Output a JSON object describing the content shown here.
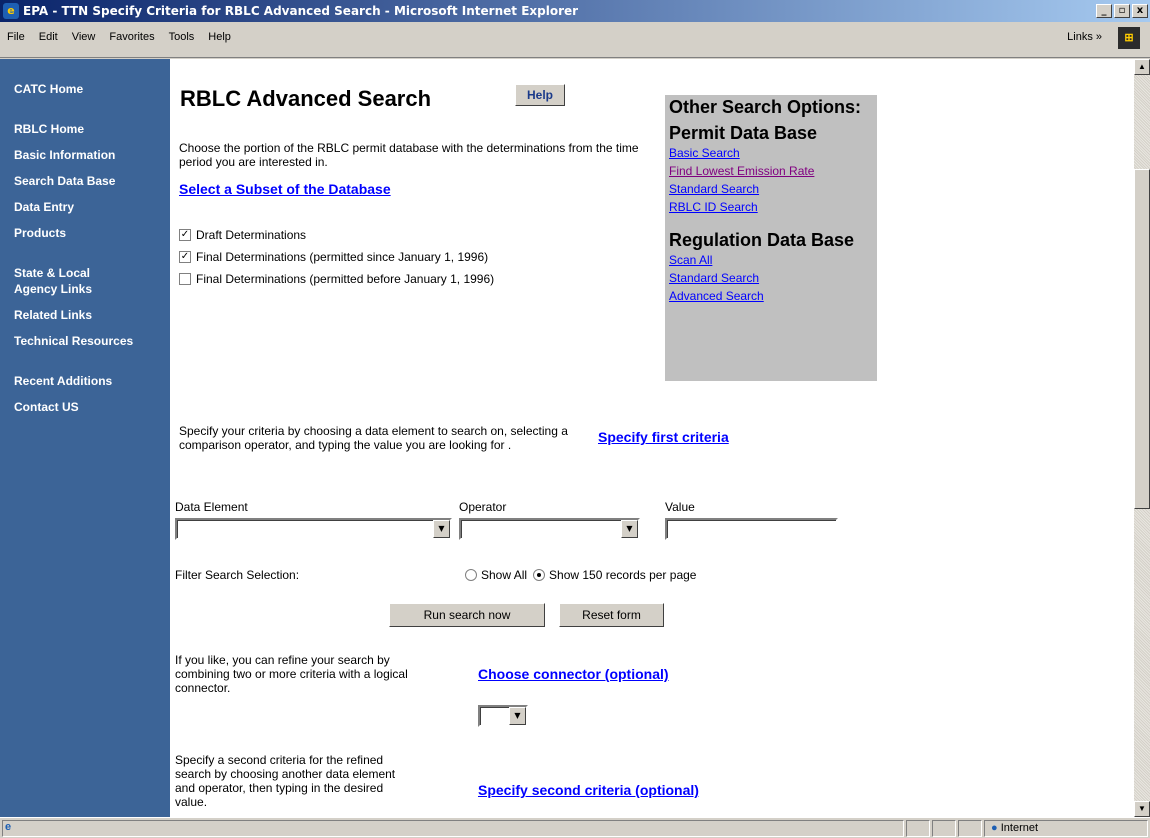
{
  "window": {
    "title": "EPA - TTN Specify Criteria for RBLC Advanced Search - Microsoft Internet Explorer",
    "minimize": "_",
    "maximize": "▫",
    "close": "x"
  },
  "menu": {
    "items": [
      "File",
      "Edit",
      "View",
      "Favorites",
      "Tools",
      "Help"
    ],
    "links_label": "Links »"
  },
  "sidebar": {
    "items": [
      "CATC Home",
      "RBLC Home",
      "Basic Information",
      "Search Data Base",
      "Data Entry",
      "Products",
      "State & Local Agency Links",
      "Related Links",
      "Technical Resources",
      "Recent Additions",
      "Contact US"
    ]
  },
  "main": {
    "heading": "RBLC Advanced Search",
    "help_label": "Help",
    "intro": "Choose the portion of the RBLC permit database with the determinations from the time period you are interested in.",
    "subset_link": "Select a Subset of the Database",
    "checkboxes": [
      {
        "label": "Draft Determinations",
        "checked": true
      },
      {
        "label": "Final Determinations (permitted since January 1, 1996)",
        "checked": true
      },
      {
        "label": "Final Determinations (permitted before January 1, 1996)",
        "checked": false
      }
    ],
    "criteria_text": "Specify your criteria by choosing a data element to search on, selecting a comparison operator, and typing the value you are looking for .",
    "first_criteria_link": "Specify first criteria",
    "data_element_label": "Data Element",
    "operator_label": "Operator",
    "value_label": "Value",
    "data_element_value": "",
    "operator_value": "",
    "value_value": "",
    "filter_label": "Filter Search Selection:",
    "radio_show_all": "Show All",
    "radio_150": "Show 150 records per page",
    "selected_radio": "Show 150 records per page",
    "run_button": "Run search now",
    "reset_button": "Reset form",
    "refine_text": "If you like, you can refine your search by combining two or more criteria with a logical connector.",
    "connector_link": "Choose connector (optional)",
    "connector_value": "",
    "second_text": "Specify a second criteria for the refined search by choosing another data element and operator, then typing in the desired value.",
    "second_criteria_link": "Specify second criteria (optional)"
  },
  "other_options": {
    "title": "Other Search Options:",
    "permit_heading": "Permit Data Base",
    "permit_links": [
      "Basic Search",
      "Find Lowest Emission Rate",
      "Standard Search",
      "RBLC ID Search"
    ],
    "regulation_heading": "Regulation Data Base",
    "regulation_links": [
      "Scan All",
      "Standard Search",
      "Advanced Search"
    ]
  },
  "status": {
    "zone": "Internet"
  },
  "colors": {
    "sidebar": "#3c6497",
    "link": "#0000ff",
    "visited_link": "#800080",
    "options_panel": "#c0c0c0"
  }
}
